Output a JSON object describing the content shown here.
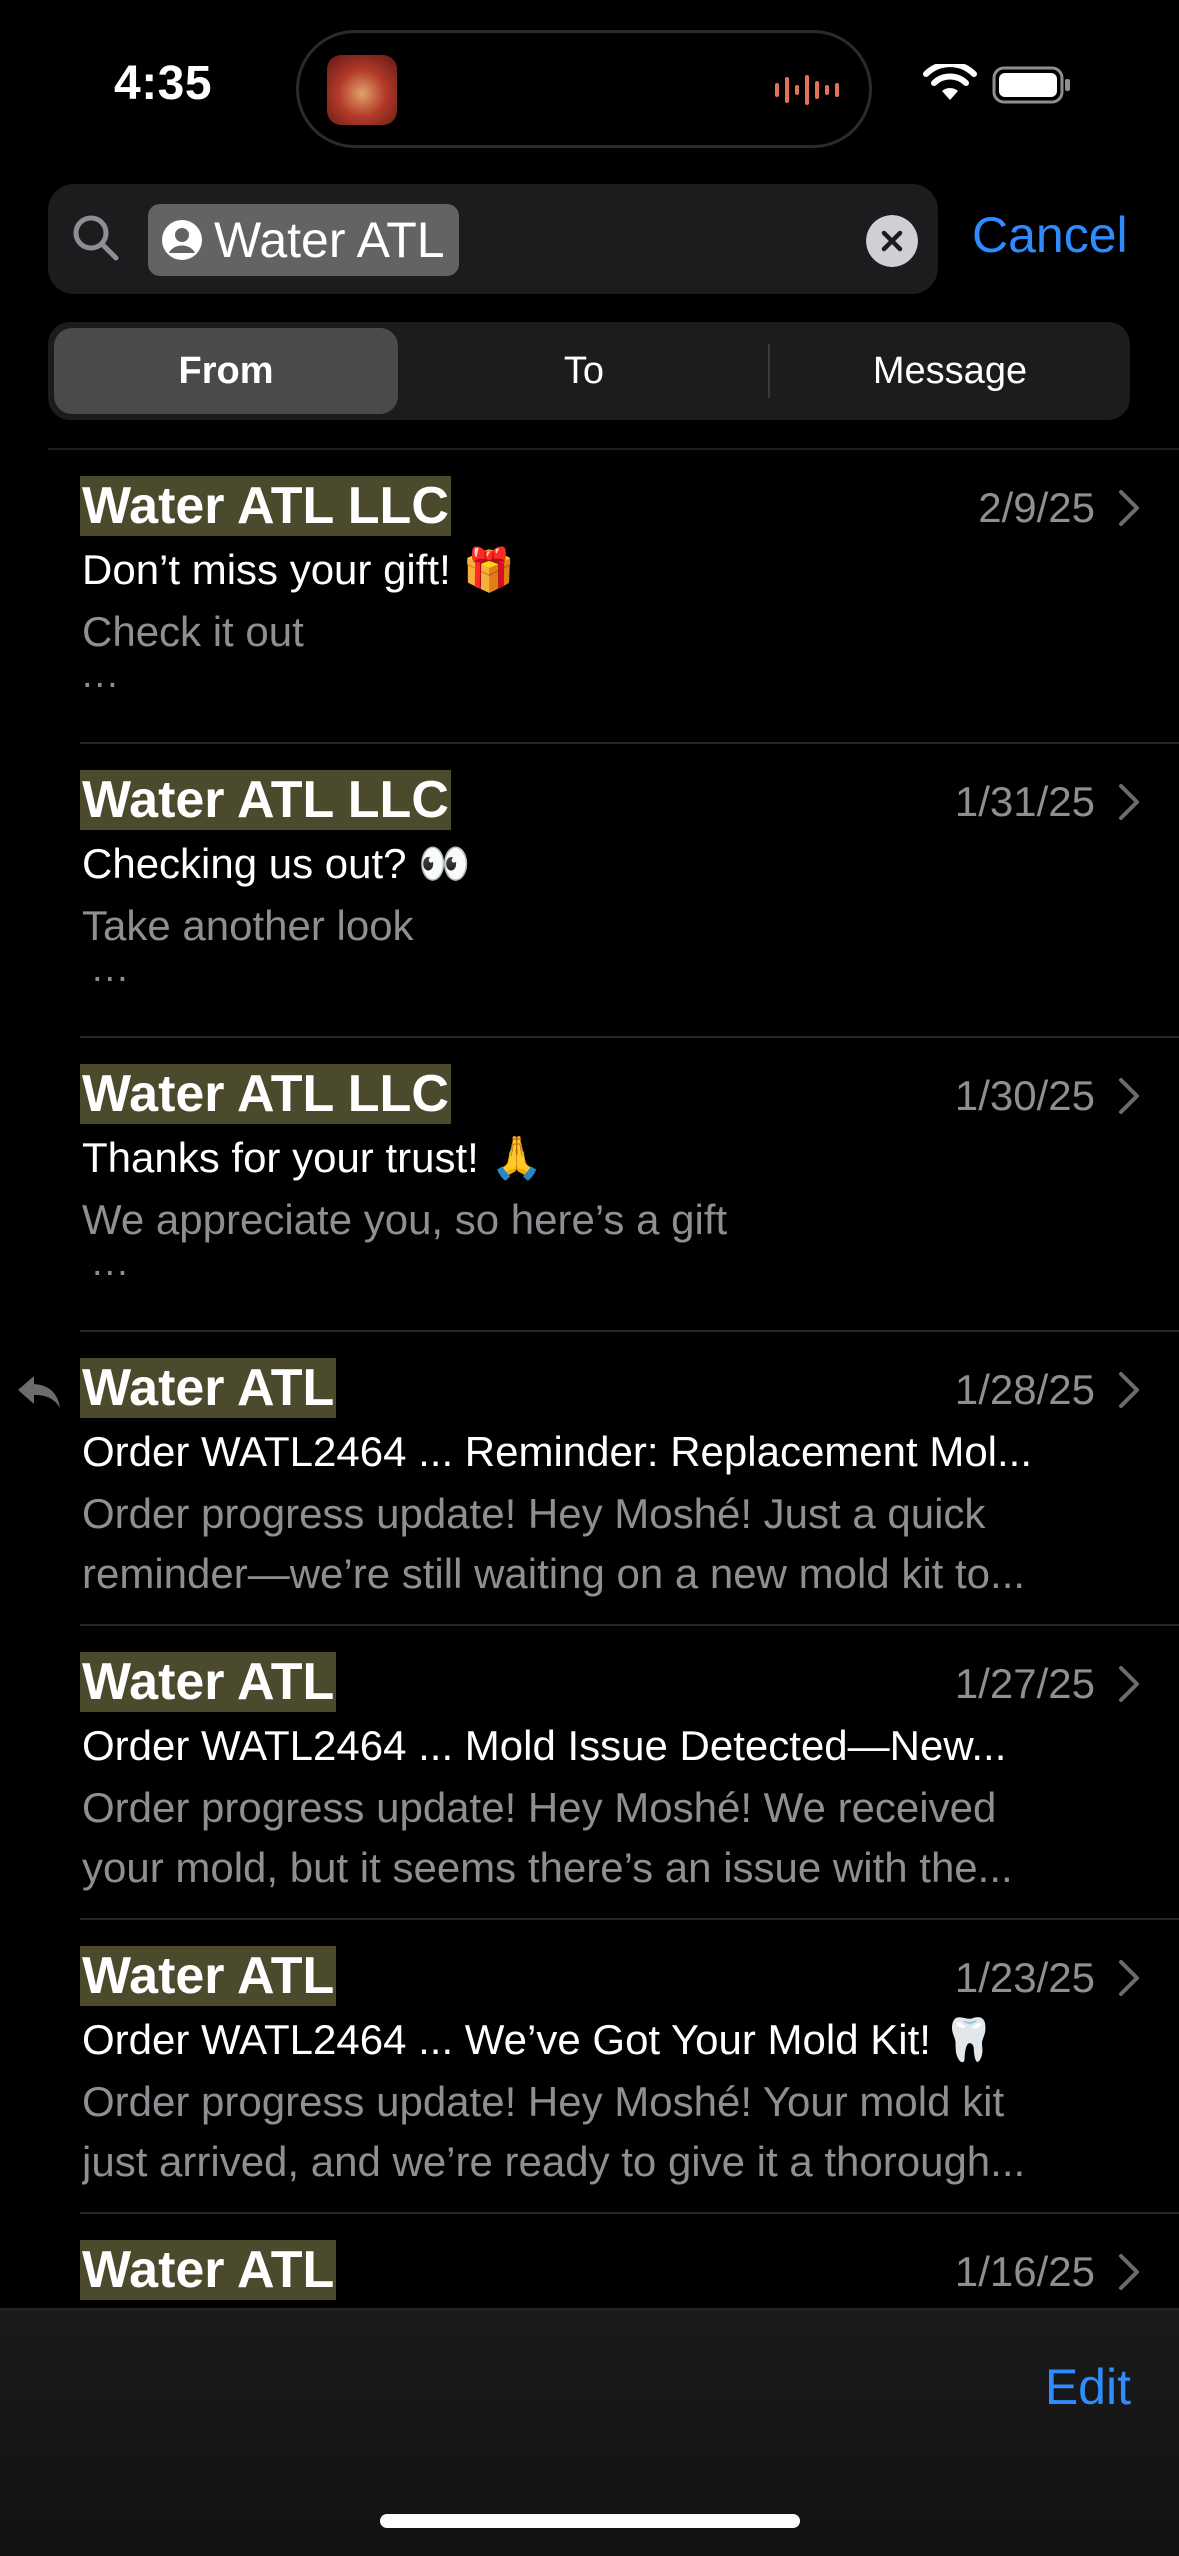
{
  "status_bar": {
    "time": "4:35",
    "icons": [
      "now-playing-artwork",
      "audio-waveform-icon",
      "wifi-icon",
      "battery-icon"
    ]
  },
  "search": {
    "token_label": "Water ATL",
    "cancel_label": "Cancel"
  },
  "scope": {
    "tabs": [
      {
        "label": "From",
        "selected": true
      },
      {
        "label": "To",
        "selected": false
      },
      {
        "label": "Message",
        "selected": false
      }
    ]
  },
  "messages": [
    {
      "sender": "Water ATL LLC",
      "date": "2/9/25",
      "subject": "Don’t miss your gift! 🎁",
      "preview": "Check it out",
      "extra": "...",
      "replied": false
    },
    {
      "sender": "Water ATL LLC",
      "date": "1/31/25",
      "subject": "Checking us out? 👀",
      "preview": "Take another look",
      "extra": "...",
      "replied": false
    },
    {
      "sender": "Water ATL LLC",
      "date": "1/30/25",
      "subject": "Thanks for your trust! 🙏",
      "preview": "We appreciate you, so here’s a gift",
      "extra": "...",
      "replied": false
    },
    {
      "sender": "Water ATL",
      "date": "1/28/25",
      "subject": "Order WATL2464 ... Reminder: Replacement Mol...",
      "preview": "Order progress update! Hey Moshé! Just a quick",
      "preview2": "reminder—we’re still waiting on a new mold kit to...",
      "replied": true
    },
    {
      "sender": "Water ATL",
      "date": "1/27/25",
      "subject": "Order WATL2464 ... Mold Issue Detected—New...",
      "preview": "Order progress update! Hey Moshé! We received",
      "preview2": "your mold, but it seems there’s an issue with the...",
      "replied": false
    },
    {
      "sender": "Water ATL",
      "date": "1/23/25",
      "subject": "Order WATL2464 ... We’ve Got Your Mold Kit! 🦷",
      "preview": "Order progress update! Hey Moshé! Your mold kit",
      "preview2": "just arrived, and we’re ready to give it a thorough...",
      "replied": false
    },
    {
      "sender": "Water ATL",
      "date": "1/16/25"
    }
  ],
  "toolbar": {
    "edit_label": "Edit"
  },
  "colors": {
    "accent": "#2f8cff",
    "highlight": "#4c4a2c",
    "secondary_text": "#8e8e93"
  }
}
